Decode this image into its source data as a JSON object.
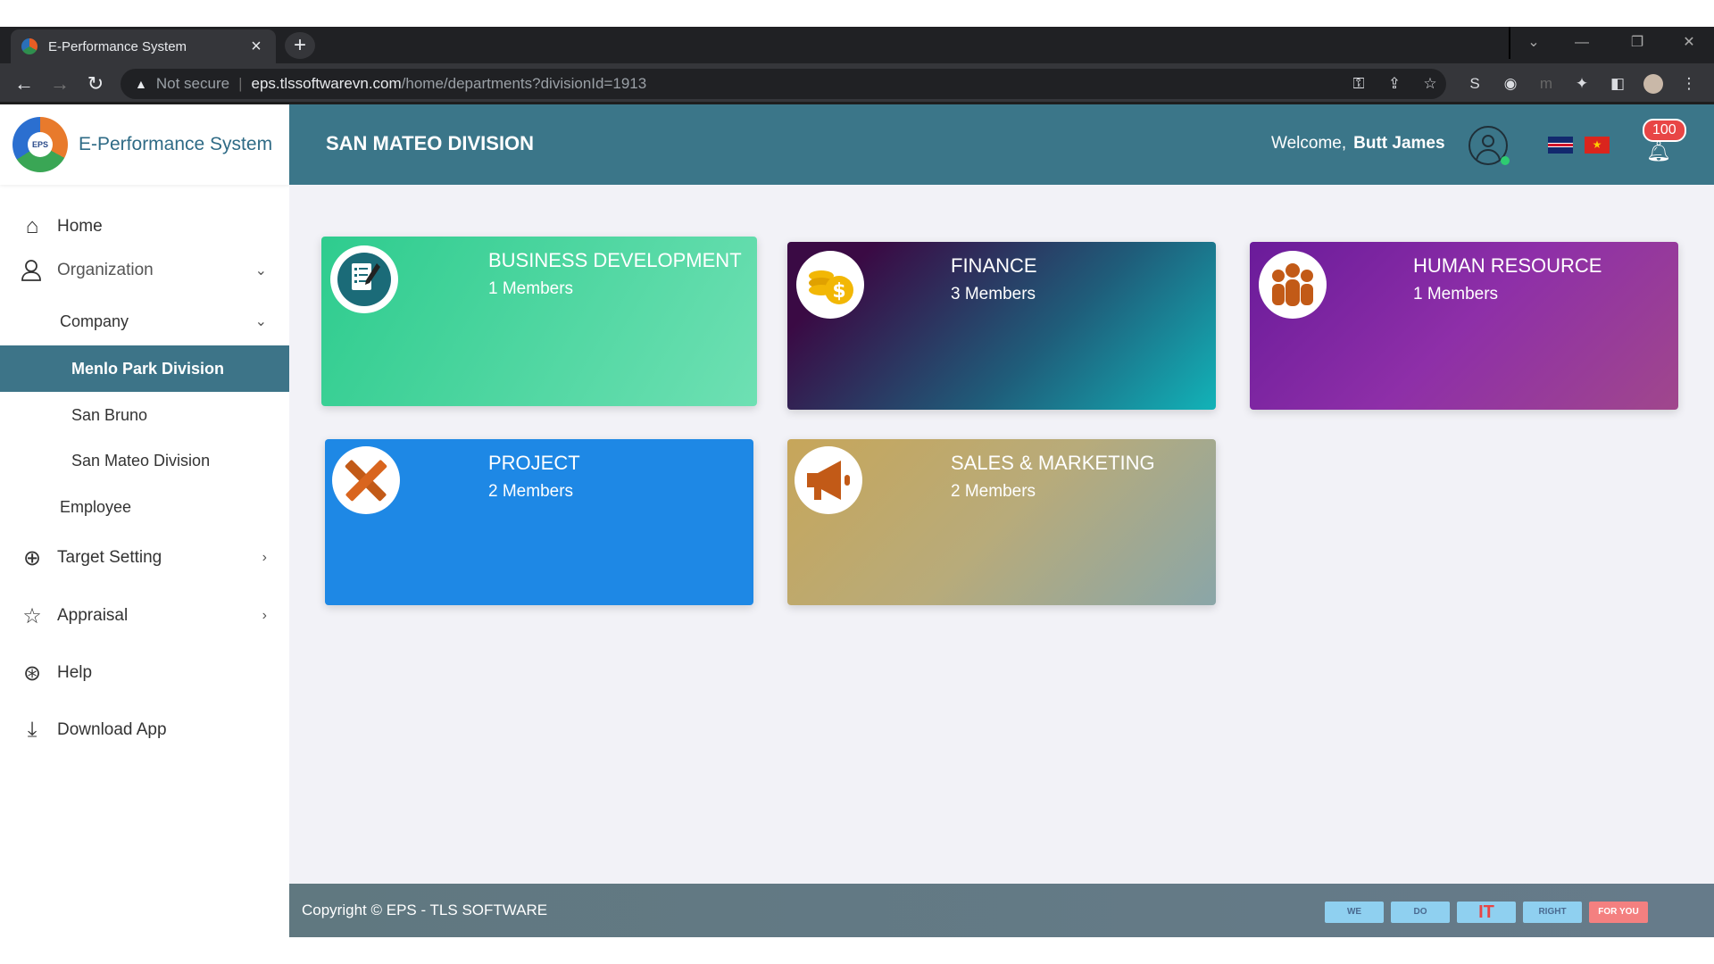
{
  "browser": {
    "tab_title": "E-Performance System",
    "tab_close": "×",
    "new_tab": "+",
    "security": "Not secure",
    "url_host": "eps.tlssoftwarevn.com",
    "url_path": "/home/departments?divisionId=1913"
  },
  "sidebar": {
    "brand": "E-Performance System",
    "logo_text": "EPS",
    "items": [
      {
        "label": "Home",
        "icon": "home-icon"
      },
      {
        "label": "Organization",
        "icon": "user-icon"
      },
      {
        "label": "Company"
      },
      {
        "label": "Menlo Park Division"
      },
      {
        "label": "San Bruno"
      },
      {
        "label": "San Mateo Division"
      },
      {
        "label": "Employee"
      },
      {
        "label": "Target Setting",
        "icon": "crosshair-icon"
      },
      {
        "label": "Appraisal",
        "icon": "star-icon"
      },
      {
        "label": "Help",
        "icon": "lifebuoy-icon"
      },
      {
        "label": "Download App",
        "icon": "download-icon"
      }
    ]
  },
  "header": {
    "title": "SAN MATEO DIVISION",
    "welcome": "Welcome,",
    "user": "Butt James",
    "notifications": "100"
  },
  "departments": [
    {
      "name": "BUSINESS DEVELOPMENT",
      "members": "1 Members",
      "icon": "checklist-icon"
    },
    {
      "name": "FINANCE",
      "members": "3 Members",
      "icon": "coins-icon"
    },
    {
      "name": "HUMAN RESOURCE",
      "members": "1 Members",
      "icon": "people-icon"
    },
    {
      "name": "PROJECT",
      "members": "2 Members",
      "icon": "ruler-pencil-icon"
    },
    {
      "name": "SALES & MARKETING",
      "members": "2 Members",
      "icon": "megaphone-icon"
    }
  ],
  "footer": {
    "copyright": "Copyright © EPS - TLS SOFTWARE",
    "slogan": [
      "WE",
      "DO",
      "IT",
      "RIGHT",
      "FOR YOU"
    ]
  },
  "colors": {
    "header": "#3b7689",
    "active_item": "#3d7488",
    "business_development": "#2ecc8e",
    "finance": "#12b3b8",
    "human_resource": "#7b1fa2",
    "project": "#1e88e5",
    "sales_marketing": "#c8a45a"
  }
}
